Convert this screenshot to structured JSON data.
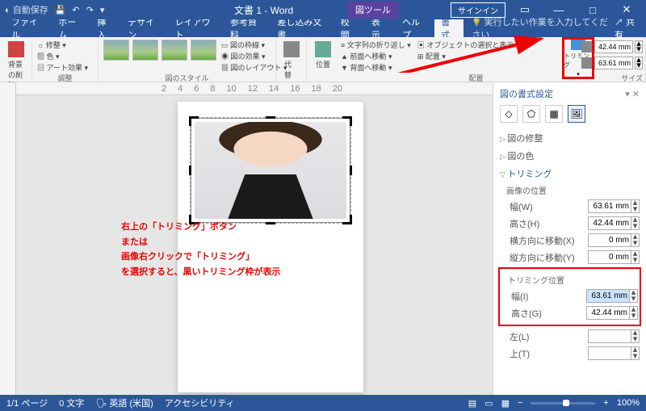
{
  "titlebar": {
    "autosave": "自動保存",
    "docname": "文書 1 - Word",
    "tooltab": "図ツール",
    "signin": "サインイン"
  },
  "menubar": {
    "tabs": [
      "ファイル",
      "ホーム",
      "挿入",
      "デザイン",
      "レイアウト",
      "参考資料",
      "差し込み文書",
      "校閲",
      "表示",
      "ヘルプ",
      "書式"
    ],
    "tell": "実行したい作業を入力してください",
    "share": "共有"
  },
  "ribbon": {
    "g0": {
      "b0": "背景の削除"
    },
    "g1": {
      "b0": "修整",
      "b1": "色",
      "b2": "アート効果",
      "name": "調整"
    },
    "g2": {
      "name": "図のスタイル",
      "b0": "図の枠線",
      "b1": "図の効果",
      "b2": "図のレイアウト"
    },
    "g3": {
      "b0": "代替テキスト"
    },
    "g4": {
      "b0": "位置",
      "b1": "文字列の折り返し",
      "b2": "前面へ移動",
      "b3": "背面へ移動",
      "b4": "オブジェクトの選択と表示",
      "b5": "配置",
      "name": "配置"
    },
    "g5": {
      "b0": "トリミング",
      "name": "サイズ",
      "h": "42.44 mm",
      "w": "63.61 mm"
    }
  },
  "ruler": [
    "2",
    "4",
    "6",
    "8",
    "10",
    "12",
    "14",
    "16",
    "18",
    "20"
  ],
  "annot": {
    "l0": "右上の「トリミング」ボタン",
    "l1": "または",
    "l2": "画像右クリックで「トリミング」",
    "l3": "を選択すると、黒いトリミング枠が表示"
  },
  "pane": {
    "title": "図の書式設定",
    "s0": "図の修整",
    "s1": "図の色",
    "s2": "トリミング",
    "sub0": "画像の位置",
    "f0": {
      "l": "幅(W)",
      "v": "63.61 mm"
    },
    "f1": {
      "l": "高さ(H)",
      "v": "42.44 mm"
    },
    "f2": {
      "l": "横方向に移動(X)",
      "v": "0 mm"
    },
    "f3": {
      "l": "縦方向に移動(Y)",
      "v": "0 mm"
    },
    "sub1": "トリミング位置",
    "f4": {
      "l": "幅(I)",
      "v": "63.61 mm"
    },
    "f5": {
      "l": "高さ(G)",
      "v": "42.44 mm"
    },
    "f6": {
      "l": "左(L)",
      "v": ""
    },
    "f7": {
      "l": "上(T)",
      "v": ""
    }
  },
  "status": {
    "page": "1/1 ページ",
    "words": "0 文字",
    "lang": "英語 (米国)",
    "acc": "アクセシビリティ",
    "zoom": "100%"
  }
}
